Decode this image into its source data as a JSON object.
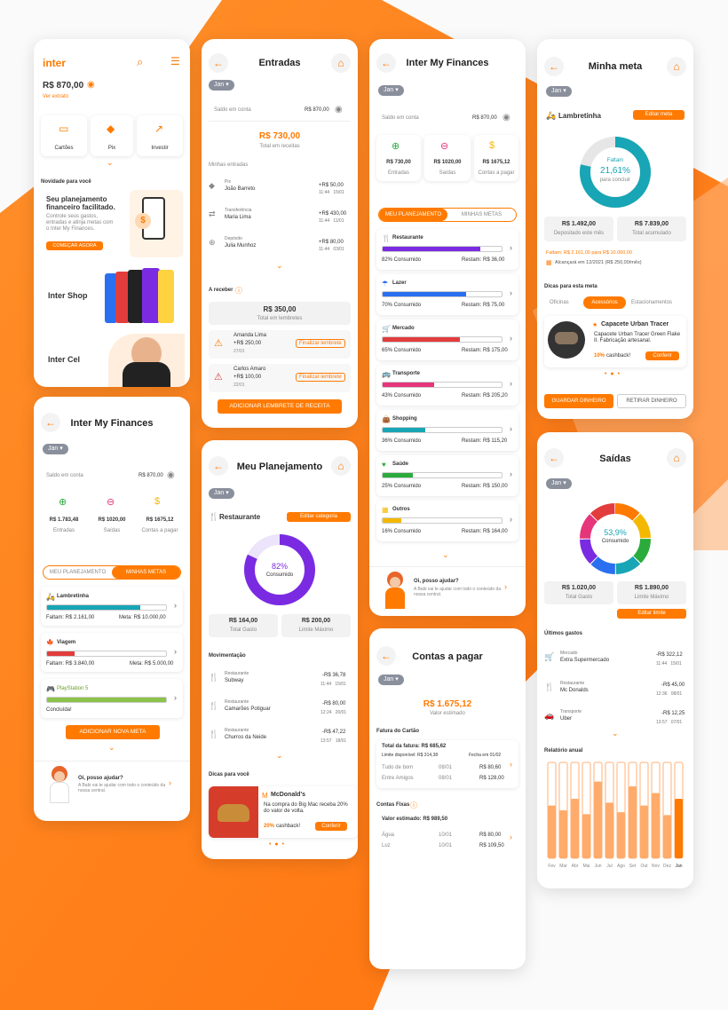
{
  "s1": {
    "logo": "inter",
    "balance": "R$ 870,00",
    "see_extract": "Ver extrato",
    "actions": [
      "Cartões",
      "Pix",
      "Investir"
    ],
    "news_title": "Novidade para você",
    "promo_title": "Seu planejamento financeiro facilitado.",
    "promo_text": "Controle seus gastos, entradas e atinja metas com o Inter My Finances.",
    "promo_cta": "COMEÇAR AGORA",
    "shop": "Inter Shop",
    "cel": "Inter Cel"
  },
  "s2": {
    "title": "Entradas",
    "month": "Jan",
    "balance_label": "Saldo em conta",
    "balance": "R$ 870,00",
    "total": "R$ 730,00",
    "total_label": "Total em receitas",
    "section": "Minhas entradas",
    "entries": [
      {
        "type": "Pix",
        "name": "João Barreto",
        "value": "+R$ 50,00",
        "time": "11:44",
        "date": "15/01"
      },
      {
        "type": "Transferência",
        "name": "Maria Lima",
        "value": "+R$ 430,00",
        "time": "11:44",
        "date": "11/01"
      },
      {
        "type": "Depósito",
        "name": "Julia Munhoz",
        "value": "+R$ 80,00",
        "time": "11:44",
        "date": "03/01"
      }
    ],
    "receive_title": "A receber",
    "receive_total": "R$ 350,00",
    "receive_total_label": "Total em lembretes",
    "reminders": [
      {
        "name": "Amanda Lima",
        "value": "+R$ 250,00",
        "date": "27/01",
        "btn": "Finalizar lembrete"
      },
      {
        "name": "Carlos Amaro",
        "value": "+R$ 100,00",
        "date": "22/01",
        "btn": "Finalizar lembrete"
      }
    ],
    "add_btn": "ADICIONAR LEMBRETE DE RECEITA"
  },
  "s3": {
    "title": "Inter My Finances",
    "month": "Jan",
    "balance_label": "Saldo em conta",
    "balance": "R$ 870,00",
    "kpis": [
      {
        "value": "R$ 730,00",
        "label": "Entradas"
      },
      {
        "value": "R$ 1020,00",
        "label": "Saídas"
      },
      {
        "value": "R$ 1675,12",
        "label": "Contas a pagar"
      }
    ],
    "tab_on": "MEU PLANEJAMENTO",
    "tab_off": "MINHAS METAS",
    "categories": [
      {
        "name": "Restaurante",
        "pct": 82,
        "consumed": "82% Consumido",
        "rest": "Restam: R$ 36,00",
        "color": "#7a2be2"
      },
      {
        "name": "Lazer",
        "pct": 70,
        "consumed": "70% Consumido",
        "rest": "Restam: R$ 75,00",
        "color": "#2a6ff0"
      },
      {
        "name": "Mercado",
        "pct": 65,
        "consumed": "65% Consumido",
        "rest": "Restam: R$ 175,00",
        "color": "#e23c3c"
      },
      {
        "name": "Transporte",
        "pct": 43,
        "consumed": "43% Consumido",
        "rest": "Restam: R$ 205,20",
        "color": "#e6357a"
      },
      {
        "name": "Shopping",
        "pct": 36,
        "consumed": "36% Consumido",
        "rest": "Restam: R$ 115,20",
        "color": "#18a5b5"
      },
      {
        "name": "Saúde",
        "pct": 25,
        "consumed": "25% Consumido",
        "rest": "Restam: R$ 150,00",
        "color": "#2bab3c"
      },
      {
        "name": "Outros",
        "pct": 16,
        "consumed": "16% Consumido",
        "rest": "Restam: R$ 164,00",
        "color": "#f5b800"
      }
    ],
    "help_title": "Oi, posso ajudar?",
    "help_text": "A Babi vai te ajudar com todo o conteúdo da nossa central."
  },
  "s4": {
    "title": "Minha meta",
    "month": "Jan",
    "goal": "Lambretinha",
    "edit": "Editar meta",
    "missing_label": "Faltam",
    "pct": "21,61%",
    "pct_value": 21.61,
    "to_complete": "para concluir",
    "deposited": "R$ 1.492,00",
    "deposited_label": "Depositado este mês",
    "accum": "R$ 7.839,00",
    "accum_label": "Total acumulado",
    "missing_line": "Faltam: R$ 2.161,00 para R$ 10.000,00",
    "reach_line": "Alcançará em 12/2021 (R$ 250,00/mês)",
    "tips_title": "Dicas para esta meta",
    "tip_tabs": [
      "Oficinas",
      "Acessórios",
      "Estacionamentos"
    ],
    "offer_title": "Capacete Urban Tracer",
    "offer_text": "Capacete Urban Tracer Green Flake II. Fabricação artesanal.",
    "offer_cash": "10%",
    "offer_cash_label": "cashback!",
    "offer_btn": "Conferir",
    "save_btn": "GUARDAR DINHEIRO",
    "withdraw_btn": "RETIRAR DINHEIRO"
  },
  "s5": {
    "title": "Inter My Finances",
    "month": "Jan",
    "balance_label": "Saldo em conta",
    "balance": "R$ 870,00",
    "kpis": [
      {
        "value": "R$ 1.783,48",
        "label": "Entradas"
      },
      {
        "value": "R$ 1020,00",
        "label": "Saídas"
      },
      {
        "value": "R$ 1675,12",
        "label": "Contas a pagar"
      }
    ],
    "tab_off": "MEU PLANEJAMENTO",
    "tab_on": "MINHAS METAS",
    "goals": [
      {
        "name": "Lambretinha",
        "pct": 78,
        "left": "Faltam: R$ 2.161,00",
        "right": "Meta: R$ 10.000,00",
        "color": "#18a5b5"
      },
      {
        "name": "Viagem",
        "pct": 23,
        "left": "Faltam: R$ 3.840,00",
        "right": "Meta: R$ 5.000,00",
        "color": "#e23c3c"
      },
      {
        "name": "PlayStation 5",
        "pct": 100,
        "left": "Concluída!",
        "right": "",
        "color": "#8bc34a"
      }
    ],
    "add_btn": "ADICIONAR NOVA META",
    "help_title": "Oi, posso ajudar?",
    "help_text": "A Babi vai te ajudar com todo o conteúdo da nossa central."
  },
  "s6": {
    "title": "Meu Planejamento",
    "month": "Jan",
    "category": "Restaurante",
    "edit": "Editar categoria",
    "pct": "82%",
    "pct_value": 82,
    "consumed": "Consumido",
    "spent": "R$ 164,00",
    "spent_label": "Total Gasto",
    "limit": "R$ 200,00",
    "limit_label": "Limite Máximo",
    "mov_title": "Movimentação",
    "movs": [
      {
        "type": "Restaurante",
        "name": "Subway",
        "value": "-R$ 36,78",
        "time": "11:44",
        "date": "15/01"
      },
      {
        "type": "Restaurante",
        "name": "Camarões Potiguar",
        "value": "-R$ 80,00",
        "time": "12:24",
        "date": "20/01"
      },
      {
        "type": "Restaurante",
        "name": "Churros da Neide",
        "value": "-R$ 47,22",
        "time": "13:57",
        "date": "18/01"
      }
    ],
    "tips_title": "Dicas para você",
    "offer_title": "McDonald's",
    "offer_text": "Na compra do Big Mac receba 20% do valor de volta.",
    "offer_cash": "20%",
    "offer_cash_label": "cashback!",
    "offer_btn": "Conferir"
  },
  "s7": {
    "title": "Saídas",
    "month": "Jan",
    "pct": "53,9%",
    "consumed": "Consumido",
    "spent": "R$ 1.020,00",
    "spent_label": "Total Gasto",
    "limit": "R$ 1.890,00",
    "limit_label": "Limite Máximo",
    "edit": "Editar limite",
    "last_title": "Últimos gastos",
    "items": [
      {
        "type": "Mercado",
        "name": "Extra Supermercado",
        "value": "-R$ 322,12",
        "time": "11:44",
        "date": "15/01"
      },
      {
        "type": "Restaurante",
        "name": "Mc Donalds",
        "value": "-R$ 45,00",
        "time": "12:36",
        "date": "08/01"
      },
      {
        "type": "Transporte",
        "name": "Uber",
        "value": "-R$ 12,25",
        "time": "13:57",
        "date": "07/01"
      }
    ],
    "annual_title": "Relatório anual",
    "months": [
      "Fev",
      "Mar",
      "Abr",
      "Mai",
      "Jun",
      "Jul",
      "Ago",
      "Set",
      "Out",
      "Nov",
      "Dez",
      "Jan"
    ],
    "annual_values": [
      55,
      50,
      62,
      46,
      80,
      58,
      48,
      75,
      55,
      68,
      45,
      62
    ],
    "ring_colors": [
      "#ff7a00",
      "#f5b800",
      "#2bab3c",
      "#18a5b5",
      "#2a6ff0",
      "#7a2be2",
      "#e6357a",
      "#e23c3c"
    ]
  },
  "s8": {
    "title": "Contas a pagar",
    "month": "Jan",
    "total": "R$ 1.675,12",
    "total_label": "Valor estimado",
    "invoice_title": "Fatura do Cartão",
    "invoice_total": "Total da fatura: R$ 685,62",
    "limit": "Limite disponível: R$ 314,38",
    "close": "Fecha em 01/02",
    "invoice_items": [
      {
        "name": "Tudo de bom",
        "date": "08/01",
        "value": "R$ 80,60"
      },
      {
        "name": "Entre Amigos",
        "date": "08/01",
        "value": "R$ 128,00"
      }
    ],
    "fixed_title": "Contas Fixas",
    "fixed_total": "Valor estimado: R$ 989,50",
    "fixed_items": [
      {
        "name": "Água",
        "date": "10/01",
        "value": "R$ 80,00"
      },
      {
        "name": "Luz",
        "date": "10/01",
        "value": "R$ 109,50"
      }
    ]
  }
}
